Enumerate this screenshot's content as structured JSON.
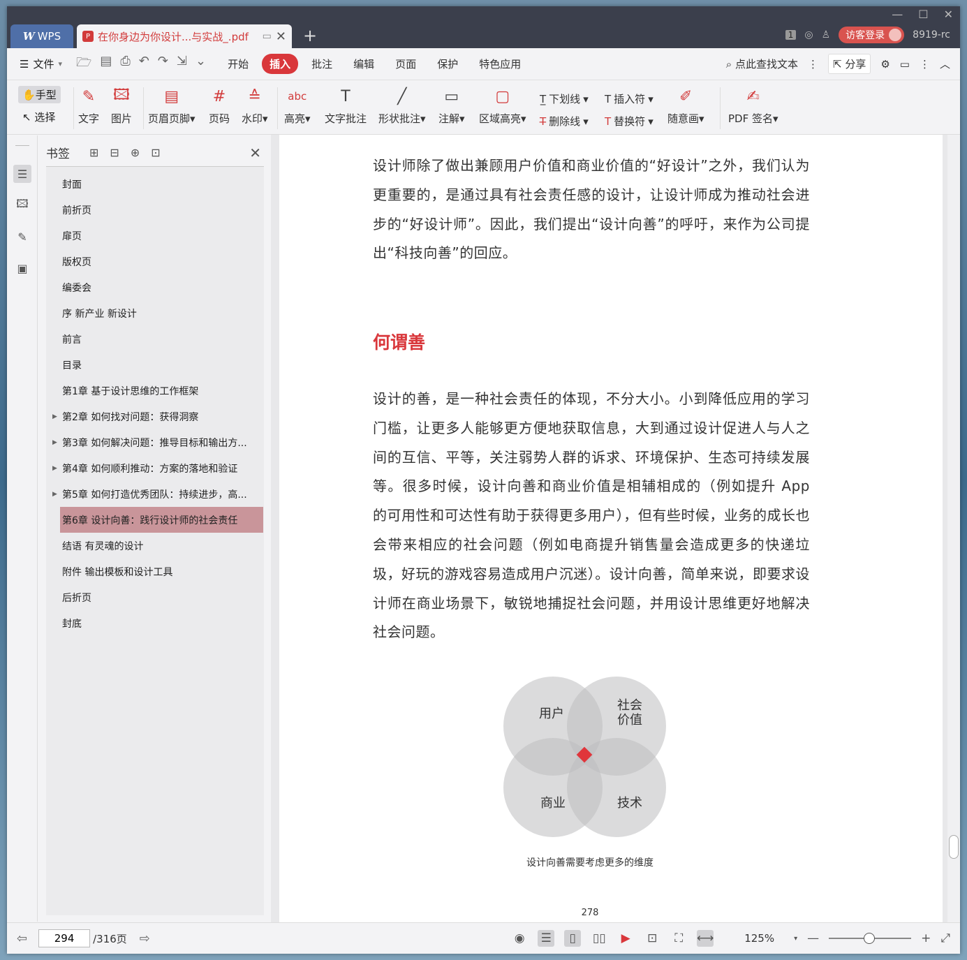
{
  "titlebar": {
    "wps_tab": "WPS",
    "doc_tab": "在你身边为你设计...与实战_.pdf",
    "page_badge": "1",
    "login": "访客登录",
    "user": "8919-rc"
  },
  "menubar": {
    "file": "文件",
    "tabs": [
      {
        "label": "开始"
      },
      {
        "label": "插入",
        "active": true
      },
      {
        "label": "批注"
      },
      {
        "label": "编辑"
      },
      {
        "label": "页面"
      },
      {
        "label": "保护"
      },
      {
        "label": "特色应用"
      }
    ],
    "search": "点此查找文本",
    "share": "分享"
  },
  "ribbon": {
    "hand": "手型",
    "select": "选择",
    "text": "文字",
    "image": "图片",
    "header_footer": "页眉页脚",
    "page_number": "页码",
    "watermark": "水印",
    "highlight": "高亮",
    "text_comment": "文字批注",
    "shape_comment": "形状批注",
    "note": "注解",
    "area_highlight": "区域高亮",
    "underline": "下划线",
    "strikethrough": "删除线",
    "insert_mark": "插入符",
    "replace_mark": "替换符",
    "freehand": "随意画",
    "pdf_sign": "PDF 签名"
  },
  "bookmarks": {
    "title": "书签",
    "items": [
      {
        "label": "封面"
      },
      {
        "label": "前折页"
      },
      {
        "label": "扉页"
      },
      {
        "label": "版权页"
      },
      {
        "label": "编委会"
      },
      {
        "label": "序 新产业 新设计"
      },
      {
        "label": "前言"
      },
      {
        "label": "目录"
      },
      {
        "label": "第1章 基于设计思维的工作框架"
      },
      {
        "label": "第2章 如何找对问题：获得洞察",
        "expandable": true
      },
      {
        "label": "第3章 如何解决问题：推导目标和输出方...",
        "expandable": true
      },
      {
        "label": "第4章 如何顺利推动：方案的落地和验证",
        "expandable": true
      },
      {
        "label": "第5章 如何打造优秀团队：持续进步，高...",
        "expandable": true
      },
      {
        "label": "第6章 设计向善：践行设计师的社会责任",
        "active": true
      },
      {
        "label": "结语 有灵魂的设计"
      },
      {
        "label": "附件 输出模板和设计工具"
      },
      {
        "label": "后折页"
      },
      {
        "label": "封底"
      }
    ]
  },
  "document": {
    "para1": "设计师除了做出兼顾用户价值和商业价值的“好设计”之外，我们认为更重要的，是通过具有社会责任感的设计，让设计师成为推动社会进步的“好设计师”。因此，我们提出“设计向善”的呼吁，来作为公司提出“科技向善”的回应。",
    "heading": "何谓善",
    "para2": "设计的善，是一种社会责任的体现，不分大小。小到降低应用的学习门槛，让更多人能够更方便地获取信息，大到通过设计促进人与人之间的互信、平等，关注弱势人群的诉求、环境保护、生态可持续发展等。很多时候，设计向善和商业价值是相辅相成的（例如提升 App 的可用性和可达性有助于获得更多用户），但有些时候，业务的成长也会带来相应的社会问题（例如电商提升销售量会造成更多的快递垃圾，好玩的游戏容易造成用户沉迷）。设计向善，简单来说，即要求设计师在商业场景下，敏锐地捕捉社会问题，并用设计思维更好地解决社会问题。",
    "venn": {
      "user": "用户",
      "social_line1": "社会",
      "social_line2": "价值",
      "business": "商业",
      "tech": "技术"
    },
    "caption": "设计向善需要考虑更多的维度",
    "page_number": "278"
  },
  "statusbar": {
    "current_page": "294",
    "total_pages": "/316页",
    "zoom": "125%"
  },
  "colors": {
    "accent": "#d9373b",
    "titlebar": "#3b3f4c",
    "bookmark_active": "#c9959a"
  }
}
